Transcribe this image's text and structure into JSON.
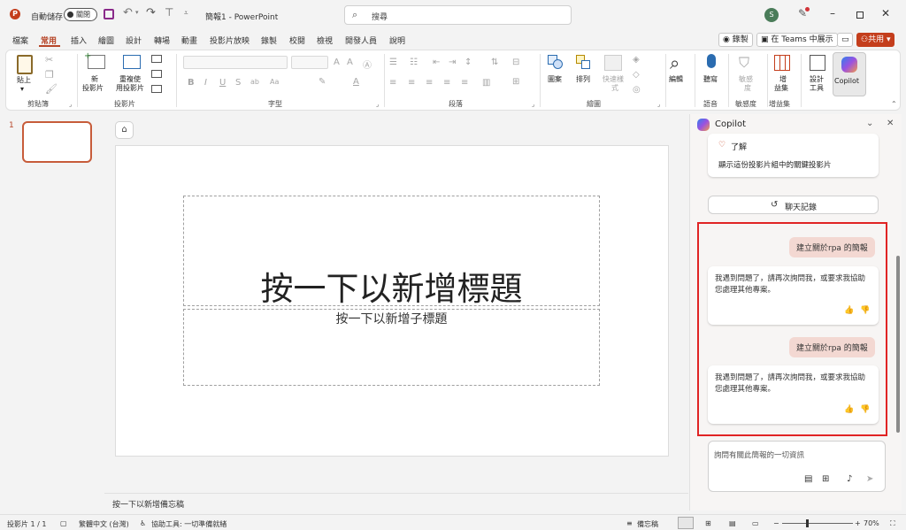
{
  "titlebar": {
    "autosave_label": "自動儲存",
    "autosave_state": "關閉",
    "doc_title": "簡報1 - PowerPoint",
    "search_placeholder": "搜尋",
    "avatar_letter": "S"
  },
  "tabs": [
    "檔案",
    "常用",
    "插入",
    "繪圖",
    "設計",
    "轉場",
    "動畫",
    "投影片放映",
    "錄製",
    "校閱",
    "檢視",
    "開發人員",
    "說明"
  ],
  "tab_actions": {
    "record": "錄製",
    "teams": "在 Teams 中展示",
    "share": "共用"
  },
  "ribbon": {
    "clipboard": {
      "paste": "貼上",
      "group": "剪貼簿"
    },
    "slides": {
      "new_slide_1": "新",
      "new_slide_2": "投影片",
      "reuse_1": "重複使",
      "reuse_2": "用投影片",
      "group": "投影片"
    },
    "font": {
      "group": "字型",
      "bold": "B",
      "italic": "I",
      "underline": "U",
      "strike": "S"
    },
    "paragraph": {
      "group": "段落"
    },
    "drawing": {
      "shapes": "圖案",
      "arrange": "排列",
      "quick_styles_1": "快速樣",
      "quick_styles_2": "式",
      "group": "繪圖"
    },
    "editing": {
      "label": "編輯"
    },
    "voice": {
      "dictate": "聽寫",
      "group": "語音"
    },
    "sensitivity": {
      "label_1": "敏感",
      "label_2": "度",
      "group": "敏感度"
    },
    "addins": {
      "label_1": "增",
      "label_2": "益集",
      "group": "增益集"
    },
    "designer": {
      "label_1": "設計",
      "label_2": "工具"
    },
    "copilot": {
      "label": "Copilot"
    }
  },
  "slides_panel": {
    "slide_number": "1"
  },
  "slide": {
    "title": "按一下以新增標題",
    "subtitle": "按一下以新增子標題"
  },
  "notes_placeholder": "按一下以新增備忘稿",
  "copilot": {
    "title": "Copilot",
    "card_top_text": "了解",
    "card_top_desc": "顯示這份投影片組中的關鍵投影片",
    "history_button": "聊天記錄",
    "messages": [
      {
        "user": "建立關於rpa 的簡報",
        "reply": "我遇到問題了，請再次詢問我，或要求我協助您處理其他專案。"
      },
      {
        "user": "建立關於rpa 的簡報",
        "reply": "我遇到問題了，請再次詢問我，或要求我協助您處理其他專案。"
      }
    ],
    "input_placeholder": "詢問有關此簡報的一切資訊"
  },
  "statusbar": {
    "slide_count": "投影片 1 / 1",
    "language": "繁體中文 (台灣)",
    "accessibility": "協助工具: 一切準備就緒",
    "notes": "備忘稿",
    "zoom": "70%"
  },
  "colors": {
    "accent": "#b7472a",
    "share": "#c43e1c",
    "highlight": "#e02424"
  }
}
